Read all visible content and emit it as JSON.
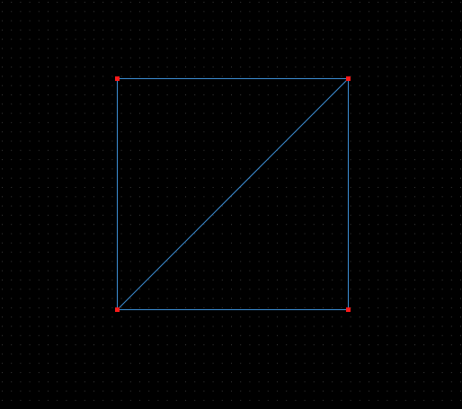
{
  "canvas": {
    "background_color": "#000000",
    "grid": {
      "visible": true,
      "color": "#3a3a3a",
      "style": "dots"
    },
    "shape": {
      "type": "square-with-diagonal",
      "edge_color": "#3d8fd6",
      "vertex_color": "#ff1a1a",
      "vertex_count": 4,
      "edge_count": 5
    }
  }
}
